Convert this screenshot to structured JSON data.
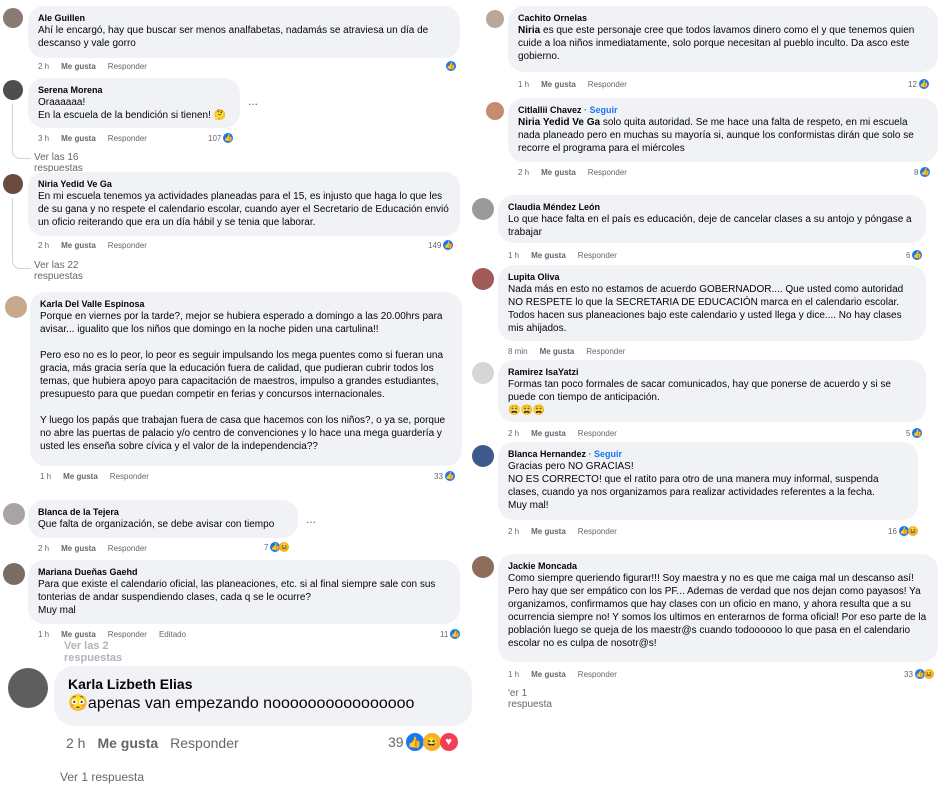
{
  "left": [
    {
      "name": "Ale Guillen",
      "text": "Ahí le encargó, hay que buscar ser menos analfabetas, nadamás se atraviesa un día de descanso y vale gorro",
      "time": "2 h",
      "like": "Me gusta",
      "reply": "Responder",
      "count": ""
    },
    {
      "name": "Serena Morena",
      "text": "Oraaaaaa!\nEn la escuela de la bendición si tienen! 🤔",
      "time": "3 h",
      "like": "Me gusta",
      "reply": "Responder",
      "count": "107",
      "replies": "Ver las 16 respuestas"
    },
    {
      "name": "Niria Yedid Ve Ga",
      "text": "En mi escuela tenemos ya actividades planeadas para el 15, es injusto que haga lo que les de su gana y no respete el calendario escolar, cuando ayer el Secretario de Educación envió un oficio reiterando que era un día hábil y se tenia que laborar.",
      "time": "2 h",
      "like": "Me gusta",
      "reply": "Responder",
      "count": "149",
      "replies": "Ver las 22 respuestas"
    },
    {
      "name": "Karla Del Valle Espinosa",
      "text": "Porque en viernes por la tarde?, mejor se hubiera esperado a domingo a las 20.00hrs para avisar... igualito que los niños que domingo en la noche piden una cartulina!!\n\nPero eso no es lo peor, lo peor es seguir impulsando los mega puentes como si fueran una gracia, más gracia sería que la educación fuera de calidad, que pudieran cubrir todos los temas, que hubiera apoyo para capacitación de maestros, impulso a grandes estudiantes, presupuesto para que puedan competir en ferias y concursos internacionales.\n\nY luego los papás que trabajan fuera de casa que hacemos con los niños?, o ya se, porque no abre las puertas de palacio y/o centro de convenciones y lo hace una mega guardería y usted les enseña sobre cívica y el valor de la independencia??",
      "time": "1 h",
      "like": "Me gusta",
      "reply": "Responder",
      "count": "33"
    },
    {
      "name": "Blanca de la Tejera",
      "text": "Que falta de organización, se debe avisar con tiempo",
      "time": "2 h",
      "like": "Me gusta",
      "reply": "Responder",
      "count": "7"
    },
    {
      "name": "Mariana Dueñas Gaehd",
      "text": "Para que existe el calendario oficial, las planeaciones, etc. si al final siempre sale con sus tonterias de andar suspendiendo clases, cada q se le ocurre?\nMuy mal",
      "time": "1 h",
      "like": "Me gusta",
      "reply": "Responder",
      "edited": "Editado",
      "count": "11"
    },
    {
      "name": "Karla Lizbeth Elias",
      "text": "😳apenas van empezando noooooooooooooooo",
      "time": "2 h",
      "like": "Me gusta",
      "reply": "Responder",
      "count": "39"
    }
  ],
  "right": [
    {
      "name": "Cachito Ornelas",
      "mention": "Niria",
      "text": " es que este personaje cree que todos lavamos dinero como el y que tenemos quien cuide a loa niños inmediatamente, solo porque necesitan al pueblo inculto. Da asco este gobierno.",
      "time": "1 h",
      "like": "Me gusta",
      "reply": "Responder",
      "count": "12"
    },
    {
      "name": "Citlallii Chavez",
      "follow": "· Seguir",
      "mention": "Niria Yedid Ve Ga",
      "text": " solo quita autoridad. Se me hace una falta de respeto, en mi escuela nada planeado pero en muchas su mayoría si, aunque los conformistas dirán que solo se recorre el programa para el miércoles",
      "time": "2 h",
      "like": "Me gusta",
      "reply": "Responder",
      "count": "8"
    },
    {
      "name": "Claudia Méndez León",
      "text": "Lo que hace falta en el país es educación, deje de cancelar clases a su antojo y póngase a trabajar",
      "time": "1 h",
      "like": "Me gusta",
      "reply": "Responder",
      "count": "6"
    },
    {
      "name": "Lupita Oliva",
      "text": "Nada más en esto no estamos de acuerdo GOBERNADOR.... Que usted como autoridad NO RESPETE lo que la SECRETARIA DE EDUCACIÓN marca en el calendario escolar. Todos hacen sus planeaciones bajo este calendario y usted llega y dice.... No hay clases mis ahijados.",
      "time": "8 min",
      "like": "Me gusta",
      "reply": "Responder",
      "count": ""
    },
    {
      "name": "Ramirez IsaYatzi",
      "text": "Formas tan poco formales de sacar comunicados, hay que ponerse de acuerdo y si se puede con tiempo de anticipación.\n😩😩😩",
      "time": "2 h",
      "like": "Me gusta",
      "reply": "Responder",
      "count": "5"
    },
    {
      "name": "Blanca Hernandez",
      "follow": "· Seguir",
      "text": "Gracias pero NO GRACIAS!\nNO ES CORRECTO! que el ratito para otro de una manera muy informal, suspenda clases, cuando ya nos organizamos para realizar actividades referentes a la fecha.\nMuy mal!",
      "time": "2 h",
      "like": "Me gusta",
      "reply": "Responder",
      "count": "16"
    },
    {
      "name": "Jackie Moncada",
      "text": "Como siempre queriendo figurar!!! Soy maestra y no es que me caiga mal un descanso así! Pero hay que ser empático con los PF... Ademas de verdad que nos dejan como payasos! Ya organizamos, confirmamos que hay clases con un oficio en mano, y ahora resulta que a su ocurrencia siempre no! Y somos los ultimos en enterarnos de forma oficial! Por eso parte de la población luego se queja de los maestr@s cuando todoooooo lo que pasa en el calendario escolar no es culpa de nosotr@s!",
      "time": "1 h",
      "like": "Me gusta",
      "reply": "Responder",
      "count": "33",
      "replies": "'er 1 respuesta"
    }
  ],
  "ellipsis": "...",
  "fragments": {
    "cut_replies": "Ver las 2 respuestas",
    "bottom": "Ver 1 respuesta"
  },
  "colors": {
    "bubble": "#f0f2f5",
    "like": "#1877f2",
    "muted": "#65676b",
    "follow": "#1877f2"
  }
}
